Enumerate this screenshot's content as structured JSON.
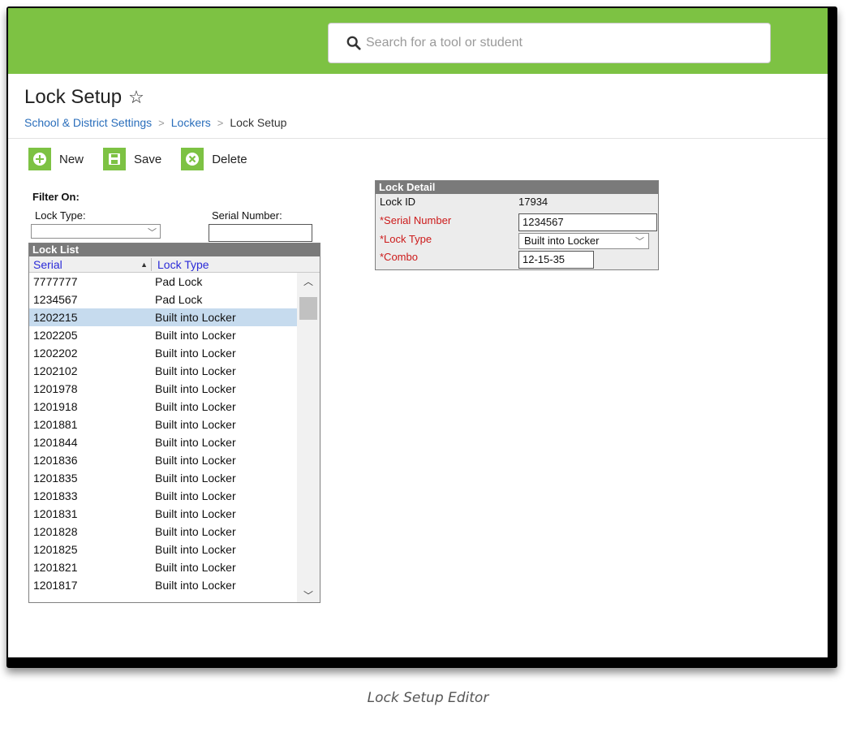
{
  "search": {
    "placeholder": "Search for a tool or student"
  },
  "page": {
    "title": "Lock Setup"
  },
  "breadcrumb": [
    "School & District Settings",
    "Lockers",
    "Lock Setup"
  ],
  "toolbar": {
    "new_label": "New",
    "save_label": "Save",
    "delete_label": "Delete"
  },
  "filter": {
    "title": "Filter On:",
    "lock_type_label": "Lock Type:",
    "lock_type_value": "",
    "serial_label": "Serial Number:",
    "serial_value": ""
  },
  "lock_list": {
    "title": "Lock List",
    "columns": [
      "Serial",
      "Lock Type"
    ],
    "selected_index": 2,
    "rows": [
      [
        "7777777",
        "Pad Lock"
      ],
      [
        "1234567",
        "Pad Lock"
      ],
      [
        "1202215",
        "Built into Locker"
      ],
      [
        "1202205",
        "Built into Locker"
      ],
      [
        "1202202",
        "Built into Locker"
      ],
      [
        "1202102",
        "Built into Locker"
      ],
      [
        "1201978",
        "Built into Locker"
      ],
      [
        "1201918",
        "Built into Locker"
      ],
      [
        "1201881",
        "Built into Locker"
      ],
      [
        "1201844",
        "Built into Locker"
      ],
      [
        "1201836",
        "Built into Locker"
      ],
      [
        "1201835",
        "Built into Locker"
      ],
      [
        "1201833",
        "Built into Locker"
      ],
      [
        "1201831",
        "Built into Locker"
      ],
      [
        "1201828",
        "Built into Locker"
      ],
      [
        "1201825",
        "Built into Locker"
      ],
      [
        "1201821",
        "Built into Locker"
      ],
      [
        "1201817",
        "Built into Locker"
      ]
    ]
  },
  "lock_detail": {
    "title": "Lock Detail",
    "lock_id_label": "Lock ID",
    "lock_id_value": "17934",
    "serial_label": "*Serial Number",
    "serial_value": "1234567",
    "lock_type_label": "*Lock Type",
    "lock_type_value": "Built into Locker",
    "combo_label": "*Combo",
    "combo_value": "12-15-35"
  },
  "caption": "Lock Setup Editor",
  "colors": {
    "header_green": "#7dc243",
    "link_blue": "#2a6ebb",
    "required_red": "#cc1a1a",
    "selected_row": "#c6dbee"
  }
}
